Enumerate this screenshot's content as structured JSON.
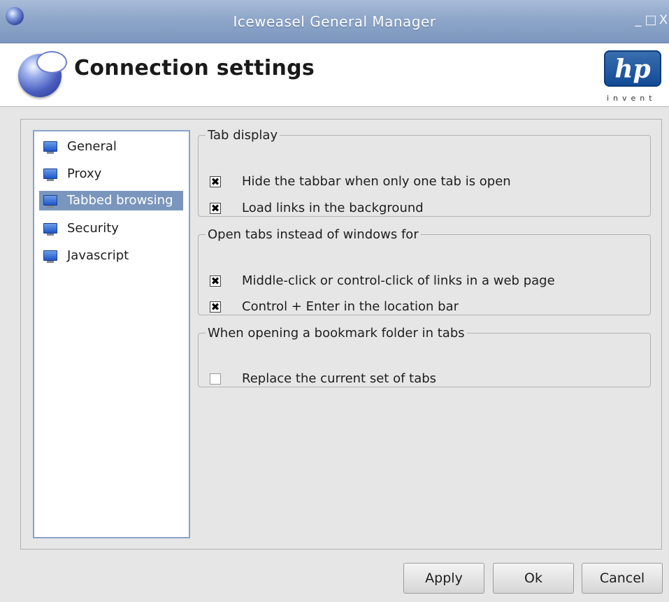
{
  "window": {
    "title": "Iceweasel General Manager",
    "minimize": "_",
    "maximize": "□",
    "close": "X"
  },
  "header": {
    "title": "Connection settings",
    "brand_mark": "hp",
    "brand_tagline": "invent"
  },
  "sidebar": {
    "items": [
      {
        "label": "General",
        "selected": false,
        "icon": "monitor-icon"
      },
      {
        "label": "Proxy",
        "selected": false,
        "icon": "monitor-icon"
      },
      {
        "label": "Tabbed browsing",
        "selected": true,
        "icon": "monitor-icon"
      },
      {
        "label": "Security",
        "selected": false,
        "icon": "monitor-icon"
      },
      {
        "label": "Javascript",
        "selected": false,
        "icon": "monitor-icon"
      }
    ]
  },
  "groups": {
    "tab_display": {
      "legend": "Tab display",
      "options": [
        {
          "label": "Hide the tabbar when only one tab is open",
          "checked": true
        },
        {
          "label": "Load links in the background",
          "checked": true
        }
      ]
    },
    "open_tabs": {
      "legend": "Open tabs instead of windows for",
      "options": [
        {
          "label": "Middle-click or control-click of links in a web page",
          "checked": true
        },
        {
          "label": "Control + Enter in the location bar",
          "checked": true
        }
      ]
    },
    "bookmark_folder": {
      "legend": "When opening a bookmark folder in tabs",
      "options": [
        {
          "label": "Replace the current set of tabs",
          "checked": false
        }
      ]
    }
  },
  "buttons": {
    "apply": "Apply",
    "ok": "Ok",
    "cancel": "Cancel"
  },
  "checkbox_mark": "✖",
  "colors": {
    "selection": "#7b96bd",
    "titlebar": "#8ea6c9",
    "hp_blue": "#114a94"
  }
}
